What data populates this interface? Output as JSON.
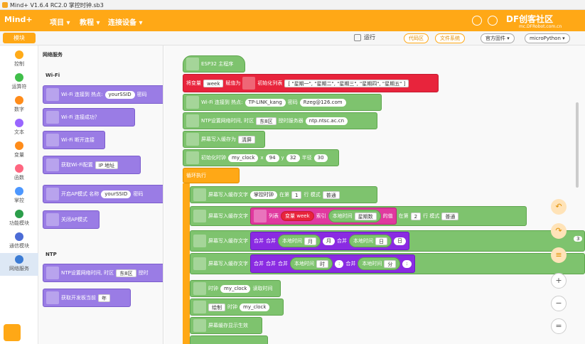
{
  "title": "Mind+ V1.6.4 RC2.0  掌控时钟.sb3",
  "menu": {
    "project": "项目 ▾",
    "tutorial": "教程 ▾",
    "connect": "连接设备 ▾"
  },
  "logo": "Mind+",
  "subbar": {
    "tab": "模块",
    "run": "运行",
    "code": "代码区",
    "files": "文件系统",
    "firmware": "官方固件 ▾",
    "lang": "microPython ▾"
  },
  "categories": [
    {
      "label": "控制",
      "color": "#ffab19"
    },
    {
      "label": "运算符",
      "color": "#40bf4a"
    },
    {
      "label": "数字",
      "color": "#ff8c1a"
    },
    {
      "label": "文本",
      "color": "#9966ff"
    },
    {
      "label": "变量",
      "color": "#ff8c1a"
    },
    {
      "label": "函数",
      "color": "#ff6680"
    },
    {
      "label": "掌控",
      "color": "#4c97ff"
    },
    {
      "label": "功能模块",
      "color": "#2c9e4b"
    },
    {
      "label": "通信模块",
      "color": "#4c6cd6"
    },
    {
      "label": "网络服务",
      "color": "#3b7bd4"
    }
  ],
  "palette": {
    "header": "网络服务",
    "wifi": "Wi-Fi",
    "ntp": "NTP",
    "b1": "Wi-Fi 连接到 热点:",
    "b1v": "yourSSID",
    "b1t": "密码",
    "b2": "Wi-Fi 连接成功？",
    "b3": "Wi-Fi 断开连接",
    "b4": "获取Wi-Fi配置",
    "b4v": "IP 地址",
    "b5": "开启AP模式 名称",
    "b5v": "yourSSID",
    "b5t": "密码",
    "b6": "关闭AP模式",
    "b7": "NTP设置网络时间, 时区",
    "b7v": "东8区",
    "b7t": "授时",
    "b8": "获取开发板当前",
    "b8v": "年"
  },
  "ws": {
    "hat": "ESP32 主程序",
    "r1a": "将变量",
    "r1b": "week",
    "r1c": "赋值为",
    "r1d": "初始化列表",
    "r1e": "[ \"星期一\", \"星期二\", \"星期三\", \"星期四\", \"星期五\" ]",
    "r2a": "Wi-Fi 连接到 热点:",
    "r2b": "TP-LINK_kang",
    "r2c": "密码",
    "r2d": "Rzeg@126.com",
    "r3a": "NTP设置网络时间, 时区",
    "r3b": "东8区",
    "r3c": "授时服务器",
    "r3d": "ntp.ntsc.ac.cn",
    "r4a": "屏幕写入缓存为",
    "r4b": "清屏",
    "r5a": "初始化时钟",
    "r5b": "my_clock",
    "r5c": "x",
    "r5d": "94",
    "r5e": "y",
    "r5f": "32",
    "r5g": "半径",
    "r5h": "30",
    "loop": "循环执行",
    "r6a": "屏幕写入缓存文字",
    "r6b": "掌控时钟",
    "r6c": "在第",
    "r6d": "1",
    "r6e": "行 模式",
    "r6f": "普通",
    "r7a": "屏幕写入缓存文字",
    "r7b": "列表",
    "r7c": "变量 week",
    "r7d": "索引",
    "r7e": "本地时间",
    "r7f": "星期数",
    "r7g": "的值",
    "r7h": "在第",
    "r7i": "2",
    "r7j": "行 模式",
    "r7k": "普通",
    "r8a": "屏幕写入缓存文字",
    "r8b": "合并",
    "r8c": "合并",
    "r8d": "本地时间",
    "r8e": "月",
    "r8f": "月",
    "r8g": "合并",
    "r8h": "本地时间",
    "r8i": "日",
    "r8j": "日",
    "r9a": "屏幕写入缓存文字",
    "r9b": "合并",
    "r9c": "合并",
    "r9d": "合并",
    "r9e": "本地时间",
    "r9f": "时",
    "r9g": ":",
    "r9h": "合并",
    "r9i": "本地时间",
    "r9j": "分",
    "r9k": ":",
    "r10a": "时钟",
    "r10b": "my_clock",
    "r10c": "读取时间",
    "r11a": "绘制",
    "r11b": "时钟",
    "r11c": "my_clock",
    "r12": "屏幕缓存显示生效"
  },
  "badge": "3",
  "watermark": "DF创客社区",
  "watermark2": "mc.DFRobot.com.cn"
}
